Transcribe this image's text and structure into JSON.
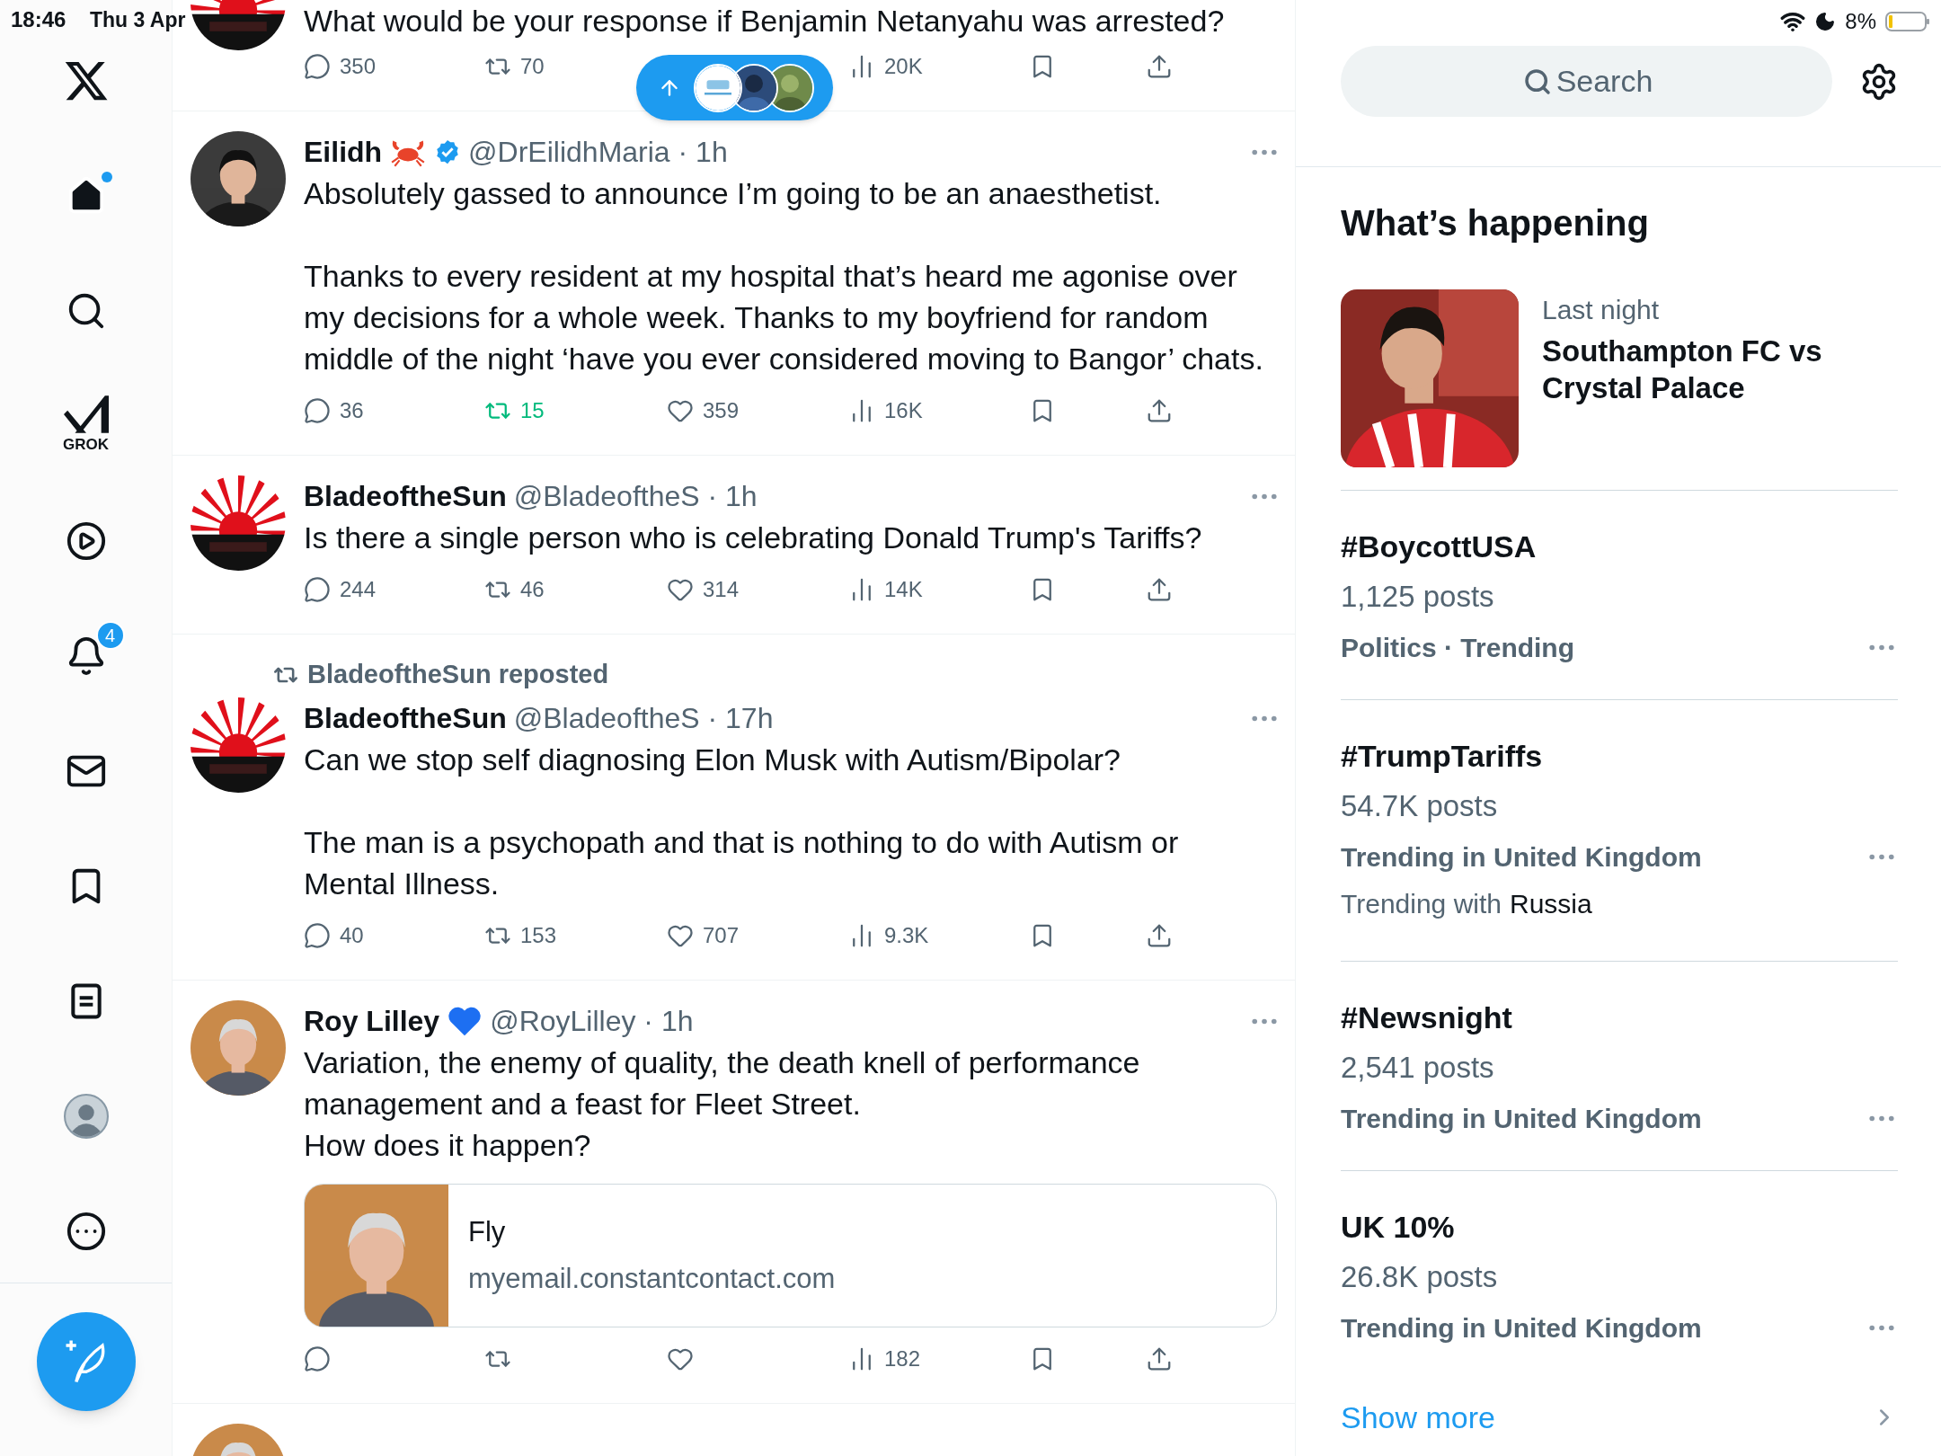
{
  "status_bar": {
    "time": "18:46",
    "date": "Thu 3 Apr",
    "battery": "8%"
  },
  "sidebar": {
    "items": [
      {
        "kind": "logo"
      },
      {
        "kind": "home",
        "selected": true,
        "dot": true
      },
      {
        "kind": "search",
        "selected": false
      },
      {
        "kind": "grok",
        "label": "GROK",
        "selected": false
      },
      {
        "kind": "video",
        "selected": false
      },
      {
        "kind": "notifications",
        "badge": "4",
        "selected": false
      },
      {
        "kind": "messages",
        "selected": false
      },
      {
        "kind": "bookmarks",
        "selected": false
      },
      {
        "kind": "lists",
        "selected": false
      },
      {
        "kind": "profile",
        "selected": false
      },
      {
        "kind": "more",
        "selected": false
      }
    ],
    "compose": {
      "kind": "compose"
    }
  },
  "new_posts_pill": {
    "avatars": [
      {
        "kind": "logo"
      },
      {
        "kind": "picture"
      },
      {
        "kind": "picture"
      }
    ]
  },
  "feed": {
    "tweets": [
      {
        "avatar": {
          "kind": "blade"
        },
        "text": "What would be your response if Benjamin Netanyahu was arrested?",
        "actions": [
          {
            "kind": "reply",
            "count": "350"
          },
          {
            "kind": "repost",
            "count": "70",
            "active": false
          },
          {
            "kind": "views",
            "count": "20K"
          },
          {
            "kind": "bookmark"
          },
          {
            "kind": "share"
          }
        ]
      },
      {
        "avatar": {
          "kind": "woman"
        },
        "name": "Eilidh",
        "badges": [
          {
            "kind": "crab"
          },
          {
            "kind": "verified"
          }
        ],
        "meta": "@DrEilidhMaria · 1h",
        "text": "Absolutely gassed to announce I’m going to be an anaesthetist.\n\nThanks to every resident at my hospital that’s heard me agonise over my decisions for a whole week. Thanks to my boyfriend for random middle of the night ‘have you ever considered moving to Bangor’ chats.",
        "actions": [
          {
            "kind": "reply",
            "count": "36"
          },
          {
            "kind": "repost",
            "count": "15",
            "active": true
          },
          {
            "kind": "like",
            "count": "359"
          },
          {
            "kind": "views",
            "count": "16K"
          },
          {
            "kind": "bookmark"
          },
          {
            "kind": "share"
          }
        ]
      },
      {
        "avatar": {
          "kind": "blade"
        },
        "name": "BladeoftheSun",
        "meta": "@BladeoftheS · 1h",
        "text": "Is there a single person who is celebrating Donald Trump's Tariffs?",
        "actions": [
          {
            "kind": "reply",
            "count": "244"
          },
          {
            "kind": "repost",
            "count": "46",
            "active": false
          },
          {
            "kind": "like",
            "count": "314"
          },
          {
            "kind": "views",
            "count": "14K"
          },
          {
            "kind": "bookmark"
          },
          {
            "kind": "share"
          }
        ]
      },
      {
        "reposted_by": "BladeoftheSun reposted",
        "avatar": {
          "kind": "blade"
        },
        "name": "BladeoftheSun",
        "meta": "@BladeoftheS · 17h",
        "text": "Can we stop self diagnosing Elon Musk with Autism/Bipolar?\n\nThe man is a psychopath and that is nothing to do with Autism or Mental Illness.",
        "actions": [
          {
            "kind": "reply",
            "count": "40"
          },
          {
            "kind": "repost",
            "count": "153",
            "active": false
          },
          {
            "kind": "like",
            "count": "707"
          },
          {
            "kind": "views",
            "count": "9.3K"
          },
          {
            "kind": "bookmark"
          },
          {
            "kind": "share"
          }
        ]
      },
      {
        "avatar": {
          "kind": "man"
        },
        "name": "Roy Lilley",
        "badges": [
          {
            "kind": "heart"
          }
        ],
        "meta": "@RoyLilley · 1h",
        "text": "Variation, the enemy of quality, the death knell of performance management and a feast for Fleet Street.\nHow does it happen?",
        "card": {
          "title": "Fly",
          "domain": "myemail.constantcontact.com"
        },
        "actions": [
          {
            "kind": "reply"
          },
          {
            "kind": "repost",
            "active": false
          },
          {
            "kind": "like"
          },
          {
            "kind": "views",
            "count": "182"
          },
          {
            "kind": "bookmark"
          },
          {
            "kind": "share"
          }
        ]
      },
      {
        "avatar": {
          "kind": "man"
        }
      }
    ]
  },
  "search": {
    "placeholder": "Search"
  },
  "whats_happening": {
    "title": "What’s happening",
    "featured": {
      "time": "Last night",
      "title": "Southampton FC vs Crystal Palace"
    },
    "trends": [
      {
        "title": "#BoycottUSA",
        "posts": "1,125 posts",
        "meta": "Politics · Trending"
      },
      {
        "title": "#TrumpTariffs",
        "posts": "54.7K posts",
        "meta": "Trending in United Kingdom",
        "trending_with": {
          "label": "Trending with",
          "topic": "Russia"
        }
      },
      {
        "title": "#Newsnight",
        "posts": "2,541 posts",
        "meta": "Trending in United Kingdom"
      },
      {
        "title": "UK 10%",
        "posts": "26.8K posts",
        "meta": "Trending in United Kingdom"
      }
    ],
    "show_more": "Show more"
  }
}
